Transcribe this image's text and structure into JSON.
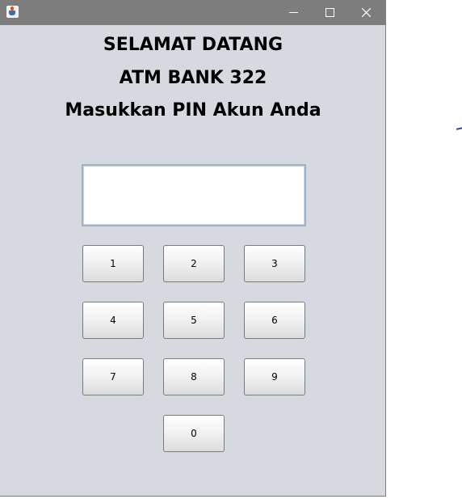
{
  "window": {
    "title": "",
    "controls": {
      "minimize_icon": "minimize-icon",
      "maximize_icon": "maximize-icon",
      "close_icon": "close-icon"
    }
  },
  "header": {
    "line1": "SELAMAT DATANG",
    "line2": "ATM BANK 322",
    "line3": "Masukkan PIN Akun Anda"
  },
  "pin_field": {
    "value": ""
  },
  "keypad": {
    "key_1": "1",
    "key_2": "2",
    "key_3": "3",
    "key_4": "4",
    "key_5": "5",
    "key_6": "6",
    "key_7": "7",
    "key_8": "8",
    "key_9": "9",
    "key_0": "0"
  },
  "colors": {
    "titlebar": "#7d7d7d",
    "window_background": "#d6d9df",
    "field_border": "#9fb3c8"
  }
}
